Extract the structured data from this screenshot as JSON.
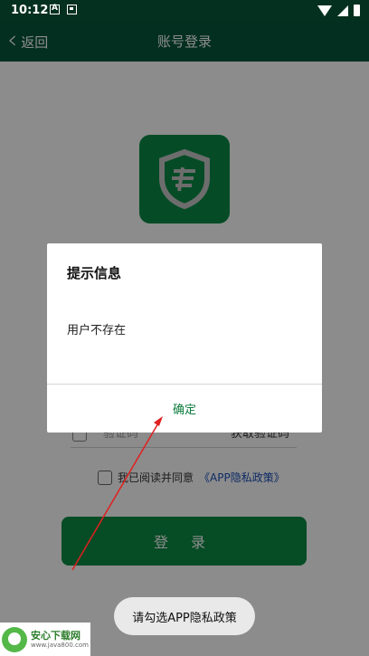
{
  "status_bar": {
    "time": "10:12"
  },
  "header": {
    "back_label": "返回",
    "title": "账号登录"
  },
  "form": {
    "code_placeholder": "验证码",
    "get_code_label": "获取验证码",
    "agree_text": "我已阅读并同意",
    "privacy_link": "《APP隐私政策》",
    "login_label": "登 录"
  },
  "dialog": {
    "title": "提示信息",
    "message": "用户不存在",
    "confirm_label": "确定"
  },
  "toast": "请勾选APP隐私政策",
  "watermark": {
    "title": "安心下载网",
    "url": "www.java800.com"
  },
  "colors": {
    "header": "#05563a",
    "primary": "#0b8a44",
    "link": "#1a4fb8",
    "annotation": "#e02020"
  }
}
